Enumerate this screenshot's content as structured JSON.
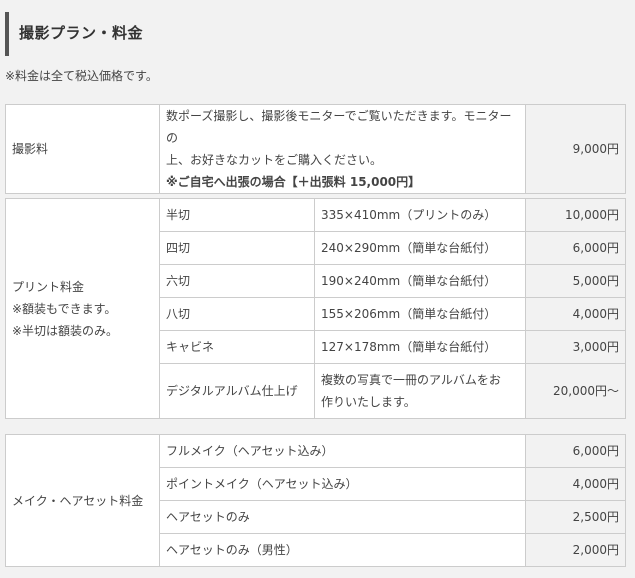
{
  "section": {
    "title": "撮影プラン・料金",
    "note": "※料金は全て税込価格です。"
  },
  "shooting": {
    "category": "撮影料",
    "desc_line1": "数ポーズ撮影し、撮影後モニターでご覧いただきます。モニターの",
    "desc_line2": "上、お好きなカットをご購入ください。",
    "desc_line3": "※ご自宅へ出張の場合【＋出張料 15,000円】",
    "price": "9,000円"
  },
  "print": {
    "category_line1": "プリント料金",
    "category_line2": "※額装もできます。",
    "category_line3": "※半切は額装のみ。",
    "rows": [
      {
        "size": "半切",
        "spec": "335×410mm（プリントのみ）",
        "price": "10,000円"
      },
      {
        "size": "四切",
        "spec": "240×290mm（簡単な台紙付）",
        "price": "6,000円"
      },
      {
        "size": "六切",
        "spec": "190×240mm（簡単な台紙付）",
        "price": "5,000円"
      },
      {
        "size": "八切",
        "spec": "155×206mm（簡単な台紙付）",
        "price": "4,000円"
      },
      {
        "size": "キャビネ",
        "spec": "127×178mm（簡単な台紙付）",
        "price": "3,000円"
      }
    ],
    "album": {
      "name": "デジタルアルバム仕上げ",
      "spec_line1": "複数の写真で一冊のアルバムをお",
      "spec_line2": "作りいたします。",
      "price": "20,000円〜"
    }
  },
  "makeup": {
    "category": "メイク・ヘアセット料金",
    "rows": [
      {
        "name": "フルメイク（ヘアセット込み）",
        "price": "6,000円"
      },
      {
        "name": "ポイントメイク（ヘアセット込み）",
        "price": "4,000円"
      },
      {
        "name": "ヘアセットのみ",
        "price": "2,500円"
      },
      {
        "name": "ヘアセットのみ（男性）",
        "price": "2,000円"
      }
    ]
  }
}
